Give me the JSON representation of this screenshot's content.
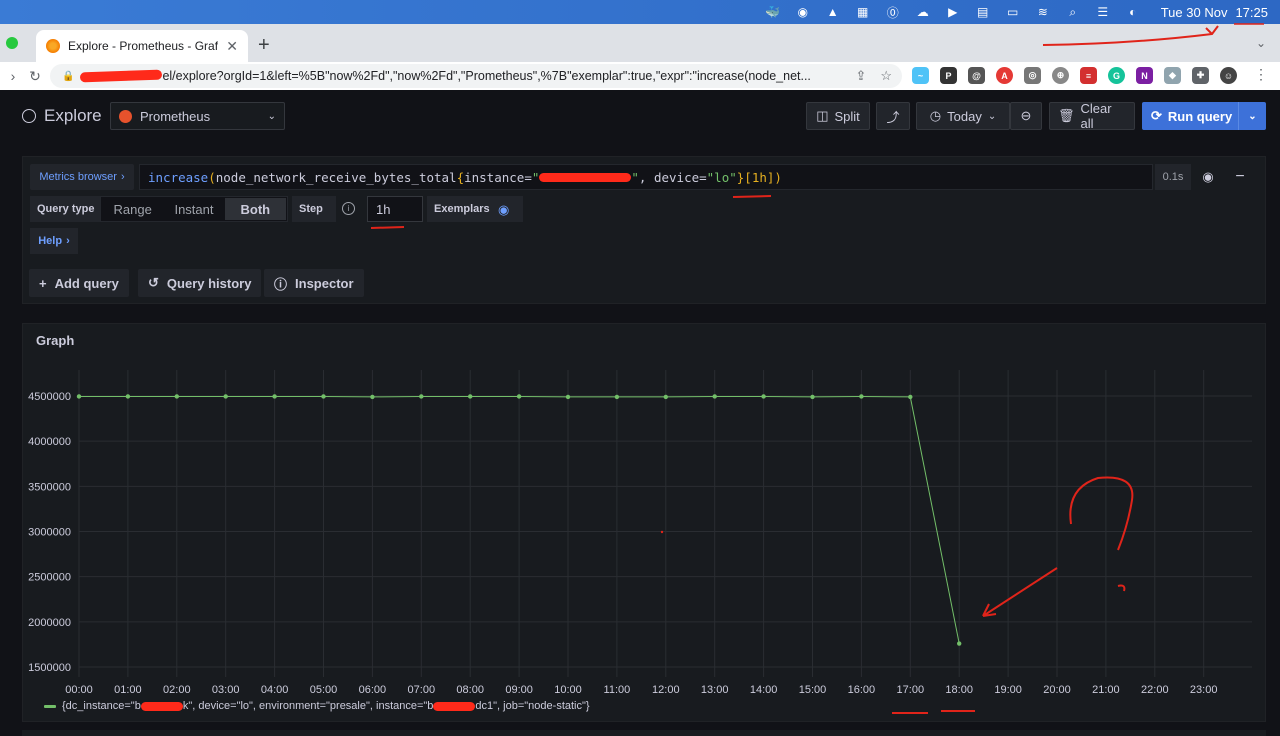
{
  "menubar": {
    "icons": [
      "docker-icon",
      "whatsapp-icon",
      "linux-icon",
      "app-icon",
      "onepassword-icon",
      "cloud-icon",
      "play-icon",
      "flag-icon",
      "battery-icon",
      "wifi-icon",
      "search-icon",
      "control-center-icon",
      "siri-icon"
    ],
    "date": "Tue 30 Nov",
    "time": "17:25"
  },
  "browser": {
    "tab_title": "Explore - Prometheus - Grafana",
    "new_tab_label": "+",
    "url": "el/explore?orgId=1&left=%5B\"now%2Fd\",\"now%2Fd\",\"Prometheus\",%7B\"exemplar\":true,\"expr\":\"increase(node_net..."
  },
  "explore": {
    "title": "Explore",
    "datasource": "Prometheus",
    "buttons": {
      "split": "Split",
      "time_range": "Today",
      "clear_all": "Clear all",
      "run_query": "Run query"
    }
  },
  "query": {
    "metrics_browser": "Metrics browser",
    "expr_fn": "increase",
    "expr_metric": "node_network_receive_bytes_total",
    "expr_label1": "instance=",
    "expr_label2": "device=",
    "expr_value2": "\"lo\"",
    "expr_range": "[1h]",
    "duration": "0.1s",
    "query_type_label": "Query type",
    "query_types": [
      "Range",
      "Instant",
      "Both"
    ],
    "active_query_type": "Both",
    "step_label": "Step",
    "step_value": "1h",
    "exemplars_label": "Exemplars",
    "help_label": "Help",
    "add_query": "Add query",
    "query_history": "Query history",
    "inspector": "Inspector"
  },
  "graph": {
    "title": "Graph",
    "legend": "{dc_instance=\"b...k\", device=\"lo\", environment=\"presale\", instance=\"b...dc1\", job=\"node-static\"}",
    "legend_parts": [
      "{dc_instance=\"b",
      "k\", device=\"lo\", environment=\"presale\", instance=\"b",
      "dc1\", job=\"node-static\"}"
    ]
  },
  "chart_data": {
    "type": "line",
    "title": "Graph",
    "xlabel": "",
    "ylabel": "",
    "x_ticks": [
      "00:00",
      "01:00",
      "02:00",
      "03:00",
      "04:00",
      "05:00",
      "06:00",
      "07:00",
      "08:00",
      "09:00",
      "10:00",
      "11:00",
      "12:00",
      "13:00",
      "14:00",
      "15:00",
      "16:00",
      "17:00",
      "18:00",
      "19:00",
      "20:00",
      "21:00",
      "22:00",
      "23:00"
    ],
    "y_ticks": [
      1500000,
      2000000,
      2500000,
      3000000,
      3500000,
      4000000,
      4500000
    ],
    "ylim": [
      1500000,
      4500000
    ],
    "grid": true,
    "legend_position": "bottom-left",
    "series": [
      {
        "color": "#73bf69",
        "x": [
          "00:00",
          "01:00",
          "02:00",
          "03:00",
          "04:00",
          "05:00",
          "06:00",
          "07:00",
          "08:00",
          "09:00",
          "10:00",
          "11:00",
          "12:00",
          "13:00",
          "14:00",
          "15:00",
          "16:00",
          "17:00",
          "18:00"
        ],
        "values": [
          4495000,
          4495000,
          4495000,
          4495000,
          4495000,
          4495000,
          4490000,
          4495000,
          4495000,
          4495000,
          4490000,
          4490000,
          4490000,
          4495000,
          4495000,
          4490000,
          4495000,
          4490000,
          1760000
        ]
      }
    ]
  }
}
